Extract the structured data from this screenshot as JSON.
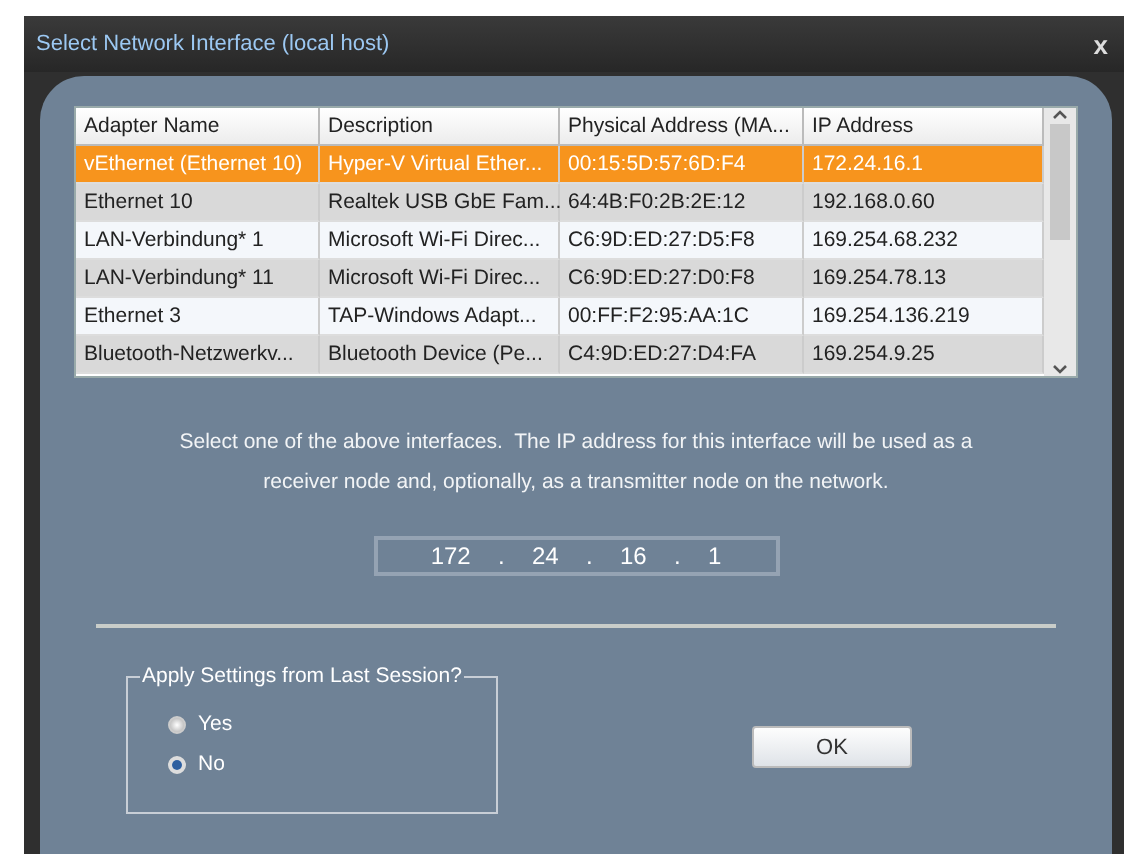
{
  "window": {
    "title": "Select Network Interface (local host)",
    "close": "x"
  },
  "table": {
    "columns": [
      "Adapter Name",
      "Description",
      "Physical  Address (MA...",
      "IP Address"
    ],
    "rows": [
      {
        "cells": [
          "vEthernet (Ethernet 10)",
          "Hyper-V Virtual Ether...",
          "00:15:5D:57:6D:F4",
          "172.24.16.1"
        ],
        "selected": true
      },
      {
        "cells": [
          "Ethernet 10",
          "Realtek USB GbE Fam...",
          "64:4B:F0:2B:2E:12",
          "192.168.0.60"
        ],
        "selected": false
      },
      {
        "cells": [
          "LAN-Verbindung* 1",
          "Microsoft Wi-Fi Direc...",
          "C6:9D:ED:27:D5:F8",
          "169.254.68.232"
        ],
        "selected": false
      },
      {
        "cells": [
          "LAN-Verbindung* 11",
          "Microsoft Wi-Fi Direc...",
          "C6:9D:ED:27:D0:F8",
          "169.254.78.13"
        ],
        "selected": false
      },
      {
        "cells": [
          "Ethernet 3",
          "TAP-Windows Adapt...",
          "00:FF:F2:95:AA:1C",
          "169.254.136.219"
        ],
        "selected": false
      },
      {
        "cells": [
          "Bluetooth-Netzwerkv...",
          "Bluetooth Device (Pe...",
          "C4:9D:ED:27:D4:FA",
          "169.254.9.25"
        ],
        "selected": false
      }
    ]
  },
  "instructions": [
    "Select one of the above interfaces.  The IP address for this interface will be used as a",
    "receiver node and, optionally, as a transmitter node on the network."
  ],
  "ip_field": {
    "octets": [
      "172",
      "24",
      "16",
      "1"
    ],
    "separator": "."
  },
  "session_group": {
    "title": "Apply Settings from Last Session?",
    "options": [
      {
        "label": "Yes",
        "selected": false
      },
      {
        "label": "No",
        "selected": true
      }
    ]
  },
  "ok_button": "OK"
}
